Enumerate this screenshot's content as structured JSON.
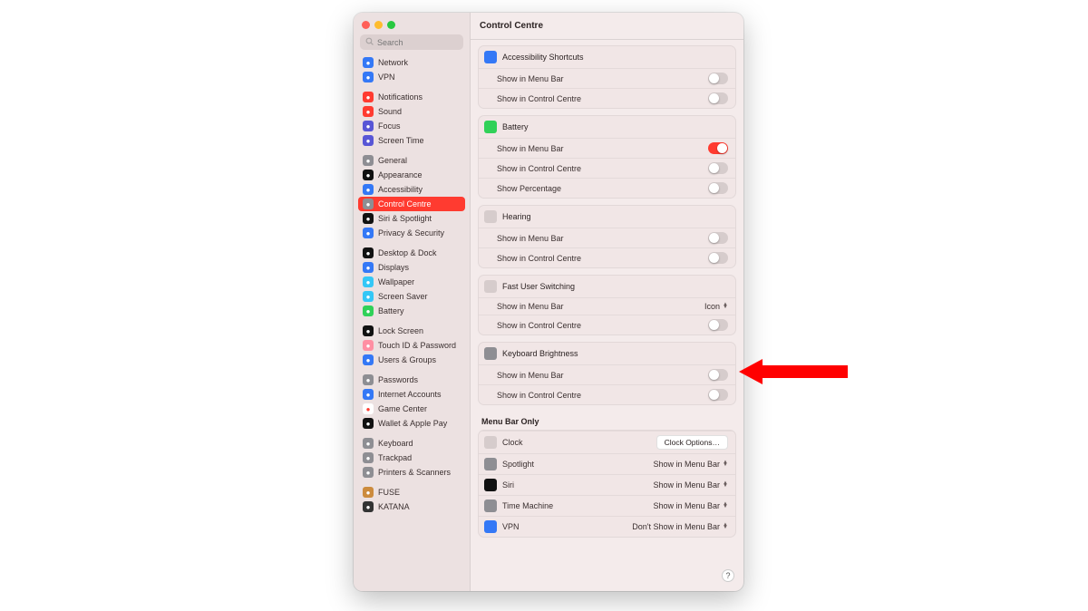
{
  "window": {
    "title": "Control Centre"
  },
  "search": {
    "placeholder": "Search"
  },
  "sidebar": {
    "groups": [
      {
        "items": [
          {
            "label": "Network",
            "icon": "globe",
            "bg": "#3478f6"
          },
          {
            "label": "VPN",
            "icon": "vpn",
            "bg": "#3478f6"
          }
        ]
      },
      {
        "items": [
          {
            "label": "Notifications",
            "icon": "bell",
            "bg": "#ff3b30"
          },
          {
            "label": "Sound",
            "icon": "sound",
            "bg": "#ff3b30"
          },
          {
            "label": "Focus",
            "icon": "moon",
            "bg": "#5856d6"
          },
          {
            "label": "Screen Time",
            "icon": "hourglass",
            "bg": "#5856d6"
          }
        ]
      },
      {
        "items": [
          {
            "label": "General",
            "icon": "gear",
            "bg": "#8e8e93"
          },
          {
            "label": "Appearance",
            "icon": "appearance",
            "bg": "#111"
          },
          {
            "label": "Accessibility",
            "icon": "access",
            "bg": "#3478f6"
          },
          {
            "label": "Control Centre",
            "icon": "sliders",
            "bg": "#8e8e93",
            "selected": true
          },
          {
            "label": "Siri & Spotlight",
            "icon": "siri",
            "bg": "#111"
          },
          {
            "label": "Privacy & Security",
            "icon": "hand",
            "bg": "#3478f6"
          }
        ]
      },
      {
        "items": [
          {
            "label": "Desktop & Dock",
            "icon": "dock",
            "bg": "#111"
          },
          {
            "label": "Displays",
            "icon": "display",
            "bg": "#3478f6"
          },
          {
            "label": "Wallpaper",
            "icon": "wallpaper",
            "bg": "#34c7f6"
          },
          {
            "label": "Screen Saver",
            "icon": "screensaver",
            "bg": "#34c7f6"
          },
          {
            "label": "Battery",
            "icon": "battery",
            "bg": "#30d158"
          }
        ]
      },
      {
        "items": [
          {
            "label": "Lock Screen",
            "icon": "lock",
            "bg": "#111"
          },
          {
            "label": "Touch ID & Password",
            "icon": "touchid",
            "bg": "#ff8fa3"
          },
          {
            "label": "Users & Groups",
            "icon": "users",
            "bg": "#3478f6"
          }
        ]
      },
      {
        "items": [
          {
            "label": "Passwords",
            "icon": "key",
            "bg": "#8e8e93"
          },
          {
            "label": "Internet Accounts",
            "icon": "at",
            "bg": "#3478f6"
          },
          {
            "label": "Game Center",
            "icon": "game",
            "bg": "#fff",
            "col": "#ff3b30"
          },
          {
            "label": "Wallet & Apple Pay",
            "icon": "wallet",
            "bg": "#111"
          }
        ]
      },
      {
        "items": [
          {
            "label": "Keyboard",
            "icon": "keyboard",
            "bg": "#8e8e93"
          },
          {
            "label": "Trackpad",
            "icon": "trackpad",
            "bg": "#8e8e93"
          },
          {
            "label": "Printers & Scanners",
            "icon": "printer",
            "bg": "#8e8e93"
          }
        ]
      },
      {
        "items": [
          {
            "label": "FUSE",
            "icon": "fuse",
            "bg": "#cc8b3d"
          },
          {
            "label": "KATANA",
            "icon": "katana",
            "bg": "#333"
          }
        ]
      }
    ]
  },
  "sections": [
    {
      "title": "Accessibility Shortcuts",
      "iconbg": "#3478f6",
      "rows": [
        {
          "label": "Show in Menu Bar",
          "control": "toggle",
          "on": false
        },
        {
          "label": "Show in Control Centre",
          "control": "toggle",
          "on": false
        }
      ]
    },
    {
      "title": "Battery",
      "iconbg": "#30d158",
      "rows": [
        {
          "label": "Show in Menu Bar",
          "control": "toggle",
          "on": true
        },
        {
          "label": "Show in Control Centre",
          "control": "toggle",
          "on": false
        },
        {
          "label": "Show Percentage",
          "control": "toggle",
          "on": false
        }
      ]
    },
    {
      "title": "Hearing",
      "iconbg": "#d6cccc",
      "rows": [
        {
          "label": "Show in Menu Bar",
          "control": "toggle",
          "on": false
        },
        {
          "label": "Show in Control Centre",
          "control": "toggle",
          "on": false
        }
      ]
    },
    {
      "title": "Fast User Switching",
      "iconbg": "#d6cccc",
      "rows": [
        {
          "label": "Show in Menu Bar",
          "control": "dropdown",
          "value": "Icon"
        },
        {
          "label": "Show in Control Centre",
          "control": "toggle",
          "on": false
        }
      ]
    },
    {
      "title": "Keyboard Brightness",
      "iconbg": "#8e8e93",
      "rows": [
        {
          "label": "Show in Menu Bar",
          "control": "toggle",
          "on": false
        },
        {
          "label": "Show in Control Centre",
          "control": "toggle",
          "on": false
        }
      ]
    }
  ],
  "menubar_only": {
    "heading": "Menu Bar Only",
    "items": [
      {
        "title": "Clock",
        "iconbg": "#d6cccc",
        "control": "button",
        "value": "Clock Options…"
      },
      {
        "title": "Spotlight",
        "iconbg": "#8e8e93",
        "control": "dropdown",
        "value": "Show in Menu Bar"
      },
      {
        "title": "Siri",
        "iconbg": "#111",
        "control": "dropdown",
        "value": "Show in Menu Bar"
      },
      {
        "title": "Time Machine",
        "iconbg": "#8e8e93",
        "control": "dropdown",
        "value": "Show in Menu Bar"
      },
      {
        "title": "VPN",
        "iconbg": "#3478f6",
        "control": "dropdown",
        "value": "Don't Show in Menu Bar"
      }
    ]
  },
  "help": "?"
}
